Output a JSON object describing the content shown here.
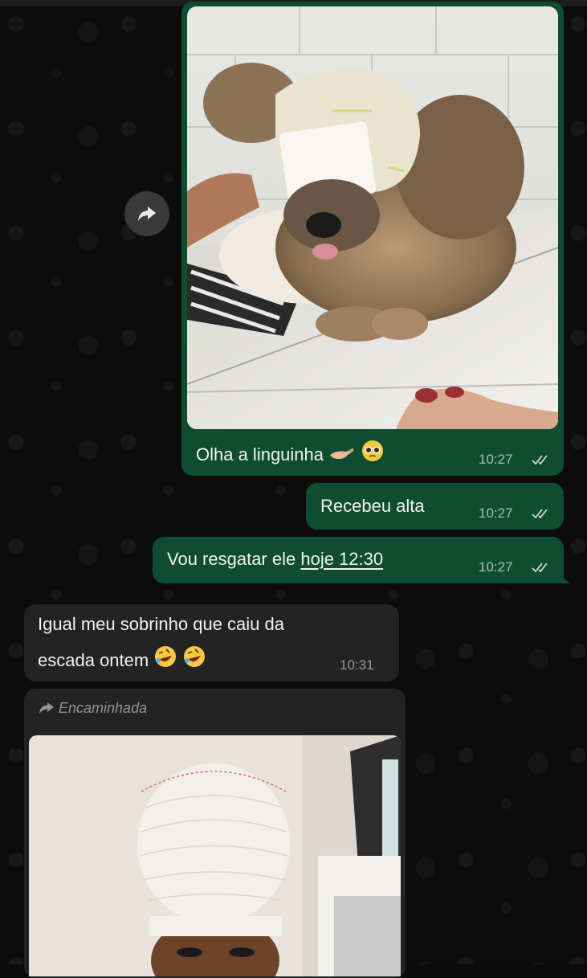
{
  "messages": {
    "photo_caption": {
      "text": "Olha a linguinha",
      "time": "10:27"
    },
    "alta": {
      "text": "Recebeu alta",
      "time": "10:27"
    },
    "resgatar": {
      "text_before": "Vou resgatar ele ",
      "link": "hoje 12:30",
      "time": "10:27"
    },
    "incoming": {
      "line1": "Igual meu sobrinho que caiu da",
      "line2": "escada ontem",
      "time": "10:31"
    },
    "forwarded": {
      "label": "Encaminhada"
    }
  },
  "icons": [
    "forward-icon",
    "double-check-icon",
    "forwarded-arrow-icon",
    "pinching-hand-emoji",
    "pleading-face-emoji",
    "rofl-emoji"
  ],
  "colors": {
    "outgoing": "#0f4d33",
    "incoming": "#232323",
    "background": "#0c0c0c"
  }
}
